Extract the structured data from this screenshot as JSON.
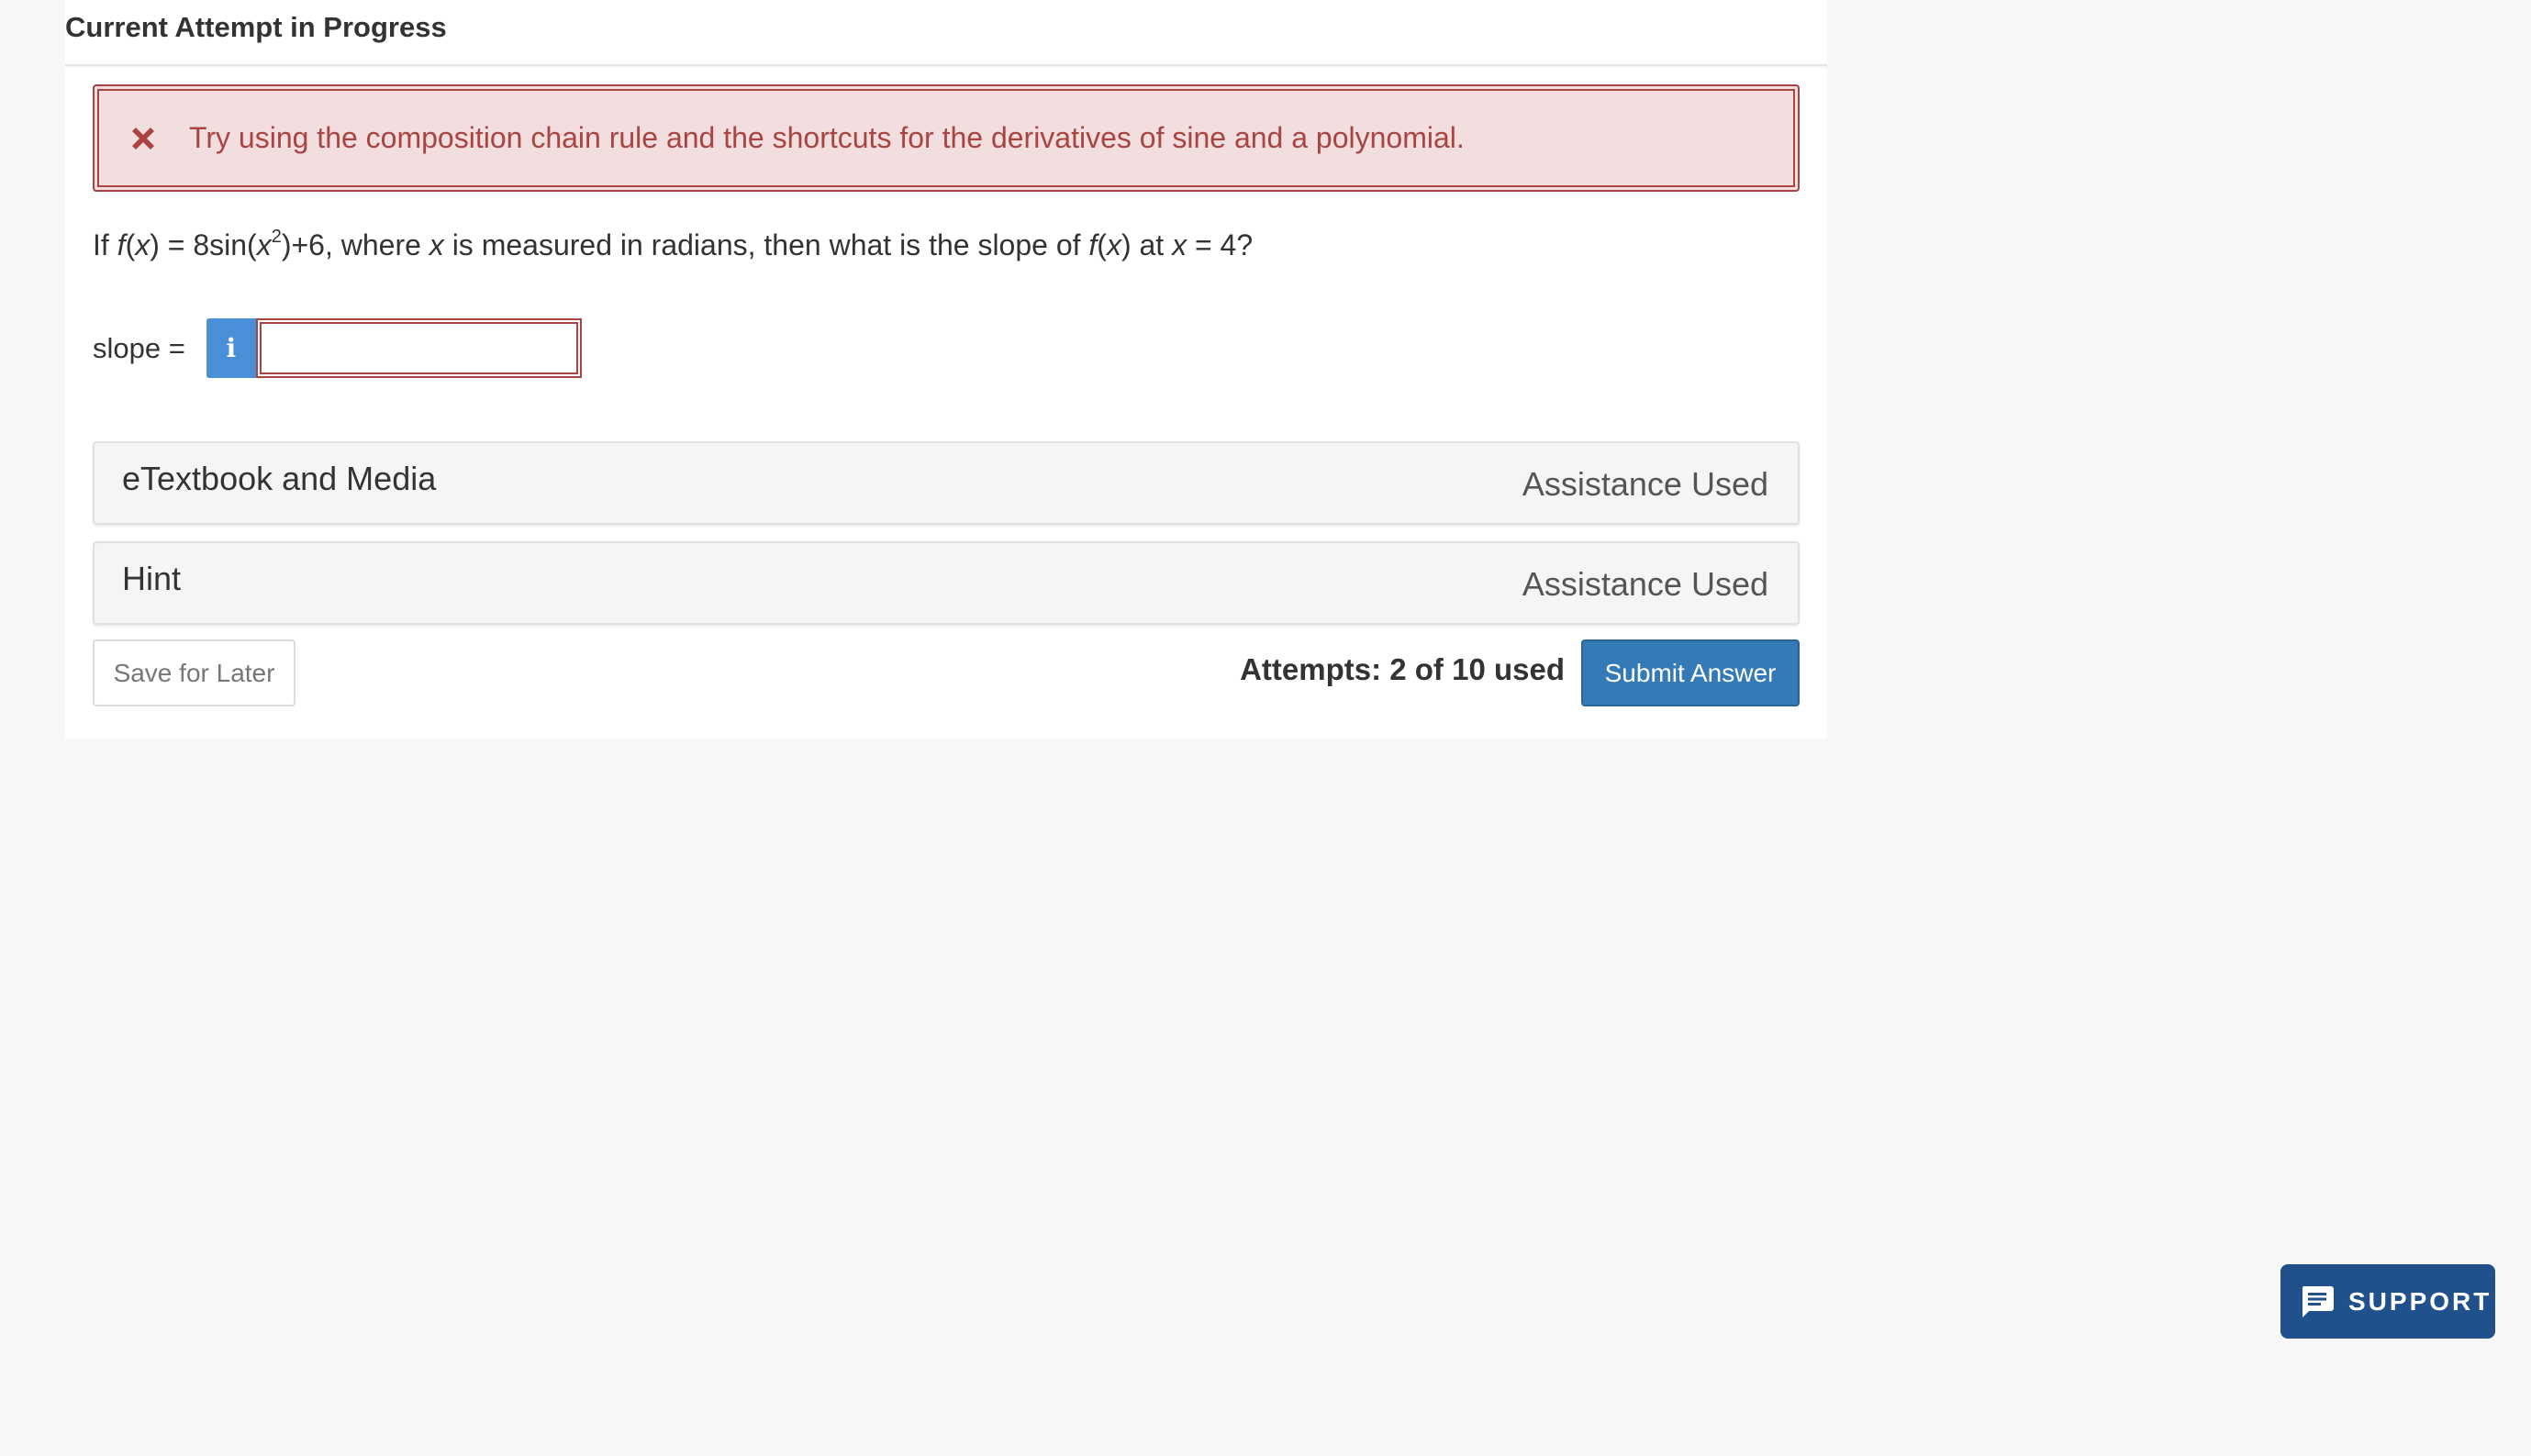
{
  "header": {
    "title": "Current Attempt in Progress"
  },
  "alert": {
    "icon": "close-icon",
    "message": "Try using the composition chain rule and the shortcuts for the derivatives of sine and a polynomial.",
    "color": "#a94442"
  },
  "question": {
    "prefix": "If ",
    "f": "f",
    "x_paren": "(x)",
    "eq_start": " = 8sin(",
    "x_var": "x",
    "exponent": "2",
    "eq_end": ")+6, where ",
    "x_var2": "x",
    "mid": " is measured in radians, then what is the slope of ",
    "f2": "f",
    "x_paren2": "(x)",
    "at": " at ",
    "x_var3": "x",
    "tail": " = 4?"
  },
  "answer": {
    "label": "slope =",
    "info_icon": "info-icon",
    "value": "",
    "placeholder": ""
  },
  "panels": [
    {
      "title": "eTextbook and Media",
      "status": "Assistance Used"
    },
    {
      "title": "Hint",
      "status": "Assistance Used"
    }
  ],
  "footer": {
    "save_label": "Save for Later",
    "attempts": "Attempts: 2 of 10 used",
    "submit_label": "Submit Answer"
  },
  "support": {
    "icon": "chat-icon",
    "label": "SUPPORT"
  },
  "colors": {
    "primary": "#337ab7",
    "support": "#20518c",
    "error": "#a94442",
    "error_bg": "#f2dede",
    "info": "#4a90d9"
  }
}
